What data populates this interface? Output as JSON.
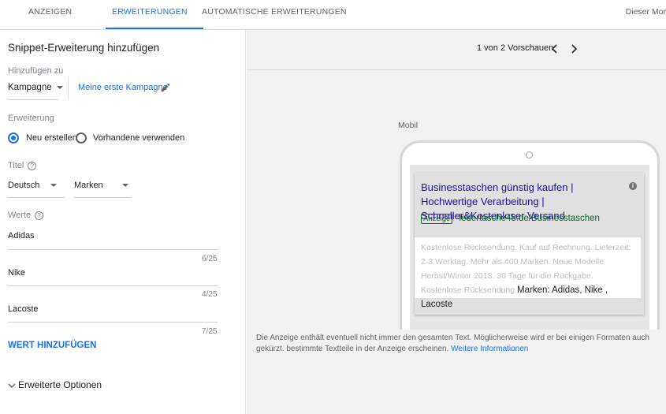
{
  "tabs": [
    {
      "label": "ANZEIGEN"
    },
    {
      "label": "ERWEITERUNGEN"
    },
    {
      "label": "AUTOMATISCHE ERWEITERUNGEN"
    }
  ],
  "tab_right": "Dieser Mor",
  "left": {
    "title": "Snippet-Erweiterung hinzufügen",
    "add_to_label": "Hinzufügen zu",
    "add_to_value": "Kampagne",
    "campaign_link": "Meine erste Kampagne",
    "extension_label": "Erweiterung",
    "radio_new": "Neu erstellen",
    "radio_existing": "Vorhandene verwenden",
    "title_label": "Titel",
    "language_value": "Deutsch",
    "header_value": "Marken",
    "values_label": "Werte",
    "values": [
      {
        "text": "Adidas",
        "counter": "6/25"
      },
      {
        "text": "Nike",
        "counter": "4/25"
      },
      {
        "text": "Lacoste",
        "counter": "7/25"
      }
    ],
    "add_value_button": "WERT HINZUFÜGEN",
    "advanced_options": "Erweiterte Optionen"
  },
  "preview": {
    "pager": "1 von 2 Vorschauen",
    "device_label": "Mobil",
    "ad_title": "Businesstaschen günstig kaufen | Hochwertige Verarbeitung | Schneller&Kostenloser Versand",
    "ad_badge": "Anzeige",
    "ad_url": "ledertasche48.de/Businesstaschen",
    "ad_desc_faded": "Kostenlose Rücksendung. Kauf auf Rechnung. Lieferzeit: 2-3 Werktag. Mehr als 400 Marken. Neue Modelle Herbst/Winter 2018. 30 Tage für die Rückgabe. Kostenlose Rücksendung",
    "ad_snippet": "Marken: Adidas, Nike , Lacoste",
    "note_text": "Die Anzeige enthält eventuell nicht immer den gesamten Text. Möglicherweise wird er bei einigen Formaten auch gekürzt. bestimmte Textteile in der Anzeige erscheinen.",
    "note_link": "Weitere Informationen"
  }
}
